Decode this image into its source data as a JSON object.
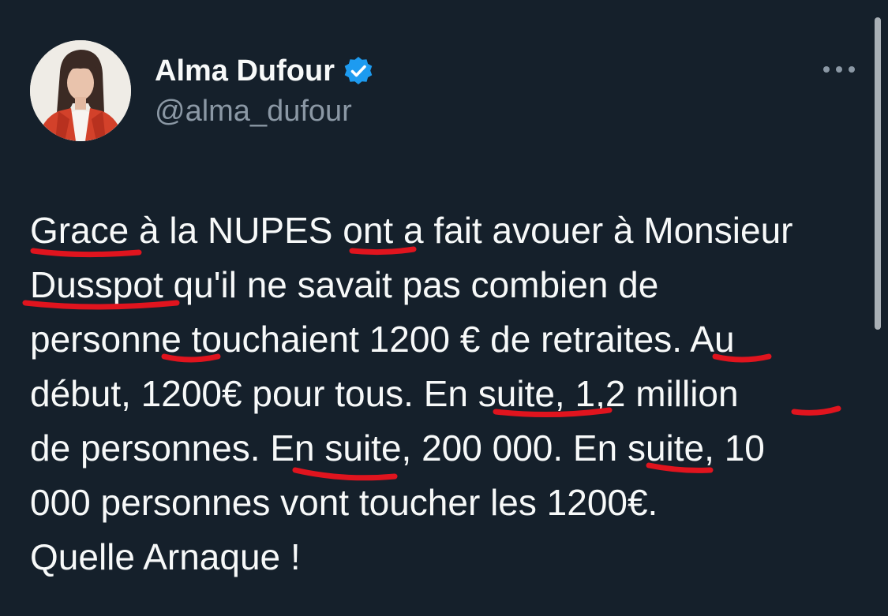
{
  "author": {
    "display_name": "Alma Dufour",
    "handle": "@alma_dufour",
    "verified": true,
    "verified_icon": "verified-badge-icon",
    "avatar_icon": "profile-photo"
  },
  "menu": {
    "icon": "more-options-icon"
  },
  "tweet": {
    "lines": [
      "Grace à la NUPES ont a fait avouer à Monsieur",
      "Dusspot qu'il ne savait pas combien de",
      "personne touchaient 1200 € de retraites. Au",
      "début, 1200€ pour tous. En suite, 1,2 million",
      "de personnes. En suite, 200 000. En suite, 10",
      "000 personnes vont toucher les 1200€.",
      "Quelle Arnaque !"
    ]
  },
  "colors": {
    "background": "#15202b",
    "text": "#f7f9f9",
    "secondary_text": "#8b98a5",
    "verified_badge": "#1d9bf0",
    "annotation_underline": "#e0141e"
  }
}
